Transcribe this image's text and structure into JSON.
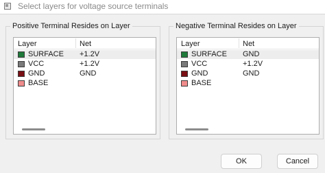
{
  "window": {
    "title": "Select layers for voltage source terminals"
  },
  "positive_group": {
    "title": "Positive Terminal Resides on Layer",
    "headers": {
      "layer": "Layer",
      "net": "Net"
    },
    "rows": [
      {
        "layer": "SURFACE",
        "net": "+1.2V",
        "color": "#1f7a3a",
        "selected": true
      },
      {
        "layer": "VCC",
        "net": "+1.2V",
        "color": "#7a7a7a",
        "selected": false
      },
      {
        "layer": "GND",
        "net": "GND",
        "color": "#7a0f14",
        "selected": false
      },
      {
        "layer": "BASE",
        "net": "",
        "color": "#f08c8c",
        "selected": false
      }
    ]
  },
  "negative_group": {
    "title": "Negative Terminal Resides on Layer",
    "headers": {
      "layer": "Layer",
      "net": "Net"
    },
    "rows": [
      {
        "layer": "SURFACE",
        "net": "GND",
        "color": "#1f7a3a",
        "selected": true
      },
      {
        "layer": "VCC",
        "net": "+1.2V",
        "color": "#7a7a7a",
        "selected": false
      },
      {
        "layer": "GND",
        "net": "GND",
        "color": "#7a0f14",
        "selected": false
      },
      {
        "layer": "BASE",
        "net": "",
        "color": "#f08c8c",
        "selected": false
      }
    ]
  },
  "buttons": {
    "ok": "OK",
    "cancel": "Cancel"
  }
}
